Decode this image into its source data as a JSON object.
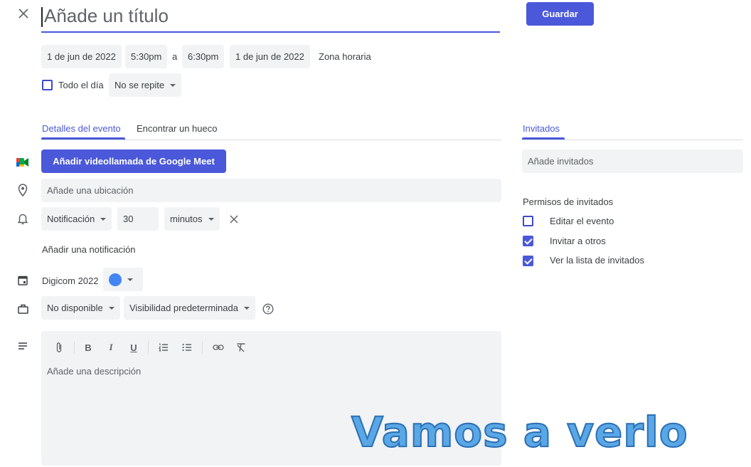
{
  "header": {
    "title_placeholder": "Añade un título",
    "save_label": "Guardar"
  },
  "datetime": {
    "start_date": "1 de jun de 2022",
    "start_time": "5:30pm",
    "separator": "a",
    "end_time": "6:30pm",
    "end_date": "1 de jun de 2022",
    "timezone_label": "Zona horaria"
  },
  "options": {
    "all_day_label": "Todo el día",
    "all_day_checked": false,
    "repeat_value": "No se repite"
  },
  "tabs": [
    {
      "label": "Detalles del evento",
      "active": true
    },
    {
      "label": "Encontrar un hueco",
      "active": false
    }
  ],
  "details": {
    "meet_button_label": "Añadir videollamada de Google Meet",
    "location_placeholder": "Añade una ubicación",
    "notification": {
      "type": "Notificación",
      "amount": "30",
      "unit": "minutos"
    },
    "add_notification_label": "Añadir una notificación",
    "calendar_name": "Digicom 2022",
    "calendar_color": "#4285f4",
    "availability": "No disponible",
    "visibility": "Visibilidad predeterminada",
    "description_placeholder": "Añade una descripción",
    "toolbar_icons": [
      "attach-icon",
      "bold-icon",
      "italic-icon",
      "underline-icon",
      "numbered-list-icon",
      "bulleted-list-icon",
      "link-icon",
      "clear-format-icon"
    ]
  },
  "guests": {
    "tab_label": "Invitados",
    "add_placeholder": "Añade invitados",
    "permissions_title": "Permisos de invitados",
    "permissions": [
      {
        "label": "Editar el evento",
        "checked": false
      },
      {
        "label": "Invitar a otros",
        "checked": true
      },
      {
        "label": "Ver la lista de invitados",
        "checked": true
      }
    ]
  },
  "overlay": {
    "caption": "Vamos a verlo"
  },
  "colors": {
    "accent": "#4a58d9",
    "chip_bg": "#f1f3f4",
    "overlay_fill": "#5aa7e6"
  }
}
